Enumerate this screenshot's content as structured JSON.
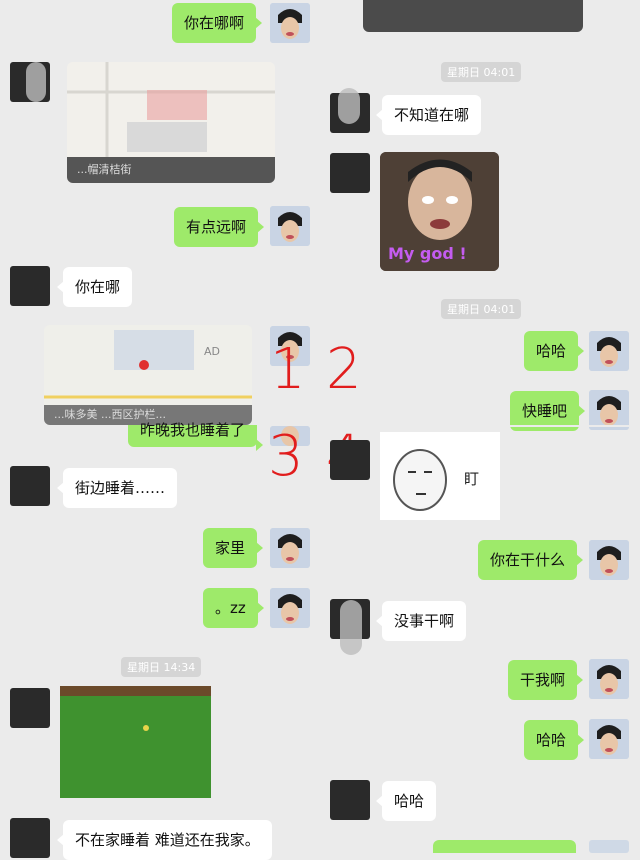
{
  "chat": {
    "messages": {
      "m1": "你在哪啊",
      "m2": "不知道在哪",
      "m3": "有点远啊",
      "m4": "你在哪",
      "m5": "哈哈",
      "m6": "快睡吧",
      "m7": "昨晚我也睡着了",
      "m8": "街边睡着……",
      "m9": "家里",
      "m10": "你在干什么",
      "m11": "。zz",
      "m12": "没事干啊",
      "m13": "干我啊",
      "m14": "哈哈",
      "m15": "哈哈",
      "m16": "不在家睡着 难道还在我家。"
    },
    "timestamps": {
      "t1": "星期日 04:01",
      "t2": "星期日 04:01",
      "t3": "星期日 14:34"
    },
    "map_labels": {
      "map1_street": "...帽清桔街",
      "map2_address": "...味多美 ...西区护栏..."
    },
    "sticker_text": {
      "my_god": "My god !",
      "stare": "盯"
    },
    "overlay_numbers": [
      "1",
      "2",
      "3",
      "4"
    ],
    "colors": {
      "background": "#ebebeb",
      "sent_bubble": "#9eea6a",
      "received_bubble": "#ffffff",
      "annotation_red": "#e11d1d"
    }
  }
}
